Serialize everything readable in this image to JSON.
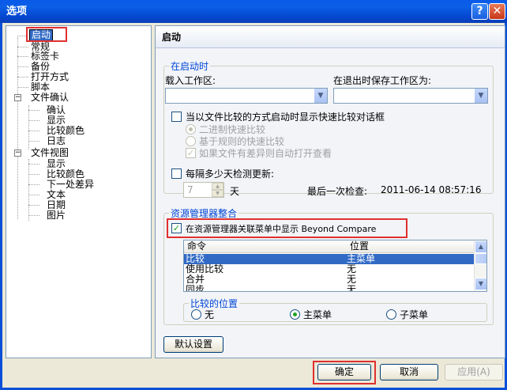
{
  "window": {
    "title": "选项",
    "help_glyph": "?",
    "close_glyph": "✕"
  },
  "tree": {
    "items": [
      {
        "label": "启动",
        "selected": true
      },
      {
        "label": "常规"
      },
      {
        "label": "标签卡"
      },
      {
        "label": "备份"
      },
      {
        "label": "打开方式"
      },
      {
        "label": "脚本"
      },
      {
        "label": "文件确认",
        "expander": "−"
      },
      {
        "label": "确认"
      },
      {
        "label": "显示"
      },
      {
        "label": "比较颜色"
      },
      {
        "label": "日志"
      },
      {
        "label": "文件视图",
        "expander": "−"
      },
      {
        "label": "显示"
      },
      {
        "label": "比较颜色"
      },
      {
        "label": "下一处差异"
      },
      {
        "label": "文本"
      },
      {
        "label": "日期"
      },
      {
        "label": "图片"
      }
    ]
  },
  "panel": {
    "title": "启动",
    "startup_group": {
      "legend": "在启动时",
      "load_workspace_label": "载入工作区:",
      "load_workspace_value": "",
      "save_on_exit_label": "在退出时保存工作区为:",
      "save_on_exit_value": "",
      "quick_compare_label": "当以文件比较的方式启动时显示快速比较对话框",
      "quick_compare_checked": false,
      "binary_quick_label": "二进制快速比较",
      "rule_quick_label": "基于规则的快速比较",
      "auto_open_label": "如果文件有差异则自动打开查看",
      "check_update_label": "每隔多少天检测更新:",
      "check_update_checked": false,
      "days_value": "7",
      "days_unit": "天",
      "last_check_label": "最后一次检查:",
      "last_check_value": "2011-06-14 08:57:16"
    },
    "explorer_group": {
      "legend": "资源管理器整合",
      "context_menu_label": "在资源管理器关联菜单中显示 Beyond Compare",
      "context_menu_checked": true,
      "columns": [
        "命令",
        "位置"
      ],
      "rows": [
        {
          "command": "比较",
          "position": "主菜单",
          "selected": true
        },
        {
          "command": "使用比较",
          "position": "无"
        },
        {
          "command": "合并",
          "position": "无"
        },
        {
          "command": "同步",
          "position": "无"
        }
      ],
      "compare_position_group": {
        "legend": "比较的位置",
        "options": [
          "无",
          "主菜单",
          "子菜单"
        ],
        "selected": "主菜单"
      }
    },
    "default_button": "默认设置"
  },
  "footer": {
    "ok": "确定",
    "cancel": "取消",
    "apply": "应用(A)"
  },
  "colors": {
    "title_bar": "#0a5ae9",
    "selection": "#316ac5",
    "highlight_box": "#e03030",
    "group_legend": "#0046d5"
  }
}
